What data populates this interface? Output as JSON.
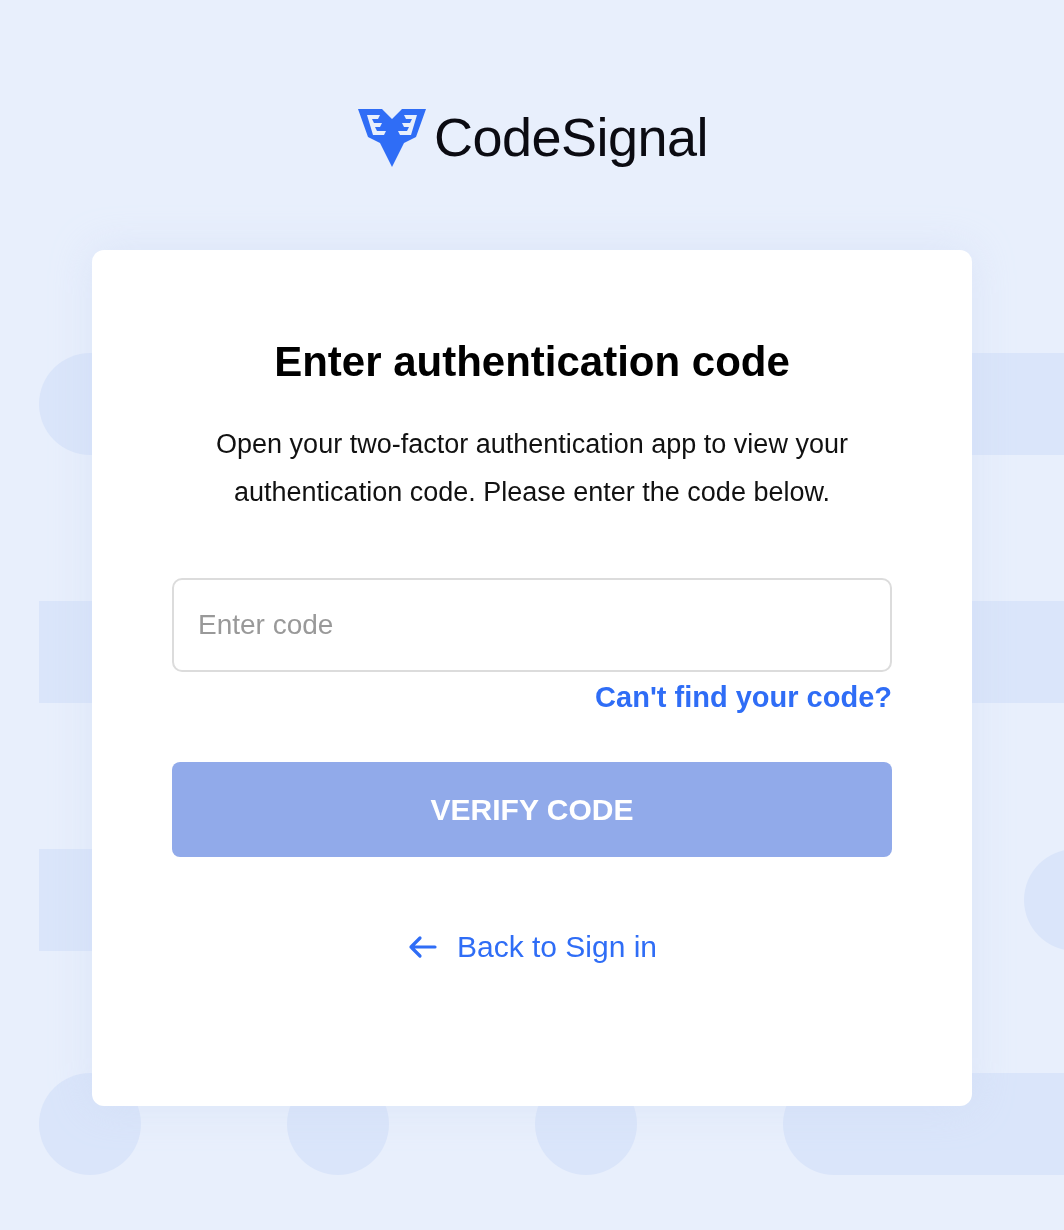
{
  "logo": {
    "text": "CodeSignal"
  },
  "card": {
    "title": "Enter authentication code",
    "description": "Open your two-factor authentication app to view your authentication code. Please enter the code below.",
    "code_field": {
      "placeholder": "Enter code"
    },
    "help_link": "Can't find your code?",
    "verify_button": {
      "label": "VERIFY CODE",
      "disabled": true
    },
    "back_link": {
      "label": "Back to Sign in"
    }
  }
}
